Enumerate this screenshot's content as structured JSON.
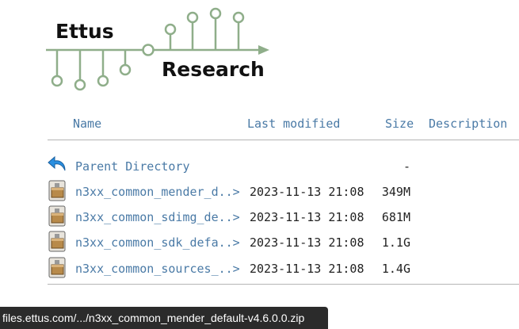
{
  "logo": {
    "line1": "Ettus",
    "line2": "Research"
  },
  "columns": {
    "name": "Name",
    "last_modified": "Last modified",
    "size": "Size",
    "description": "Description"
  },
  "parent": {
    "label": "Parent Directory",
    "size": "-",
    "icon": "back-arrow-icon"
  },
  "files": [
    {
      "name": "n3xx_common_mender_d..>",
      "date": "2023-11-13 21:08",
      "size": "349M",
      "icon": "archive-file-icon"
    },
    {
      "name": "n3xx_common_sdimg_de..>",
      "date": "2023-11-13 21:08",
      "size": "681M",
      "icon": "archive-file-icon"
    },
    {
      "name": "n3xx_common_sdk_defa..>",
      "date": "2023-11-13 21:08",
      "size": "1.1G",
      "icon": "archive-file-icon"
    },
    {
      "name": "n3xx_common_sources_..>",
      "date": "2023-11-13 21:08",
      "size": "1.4G",
      "icon": "archive-file-icon"
    }
  ],
  "status_bar": {
    "url": "files.ettus.com/.../n3xx_common_mender_default-v4.6.0.0.zip"
  },
  "colors": {
    "link": "#4a7aa6",
    "logo_green": "#8fae8a",
    "status_bg": "#2b2b2b"
  }
}
